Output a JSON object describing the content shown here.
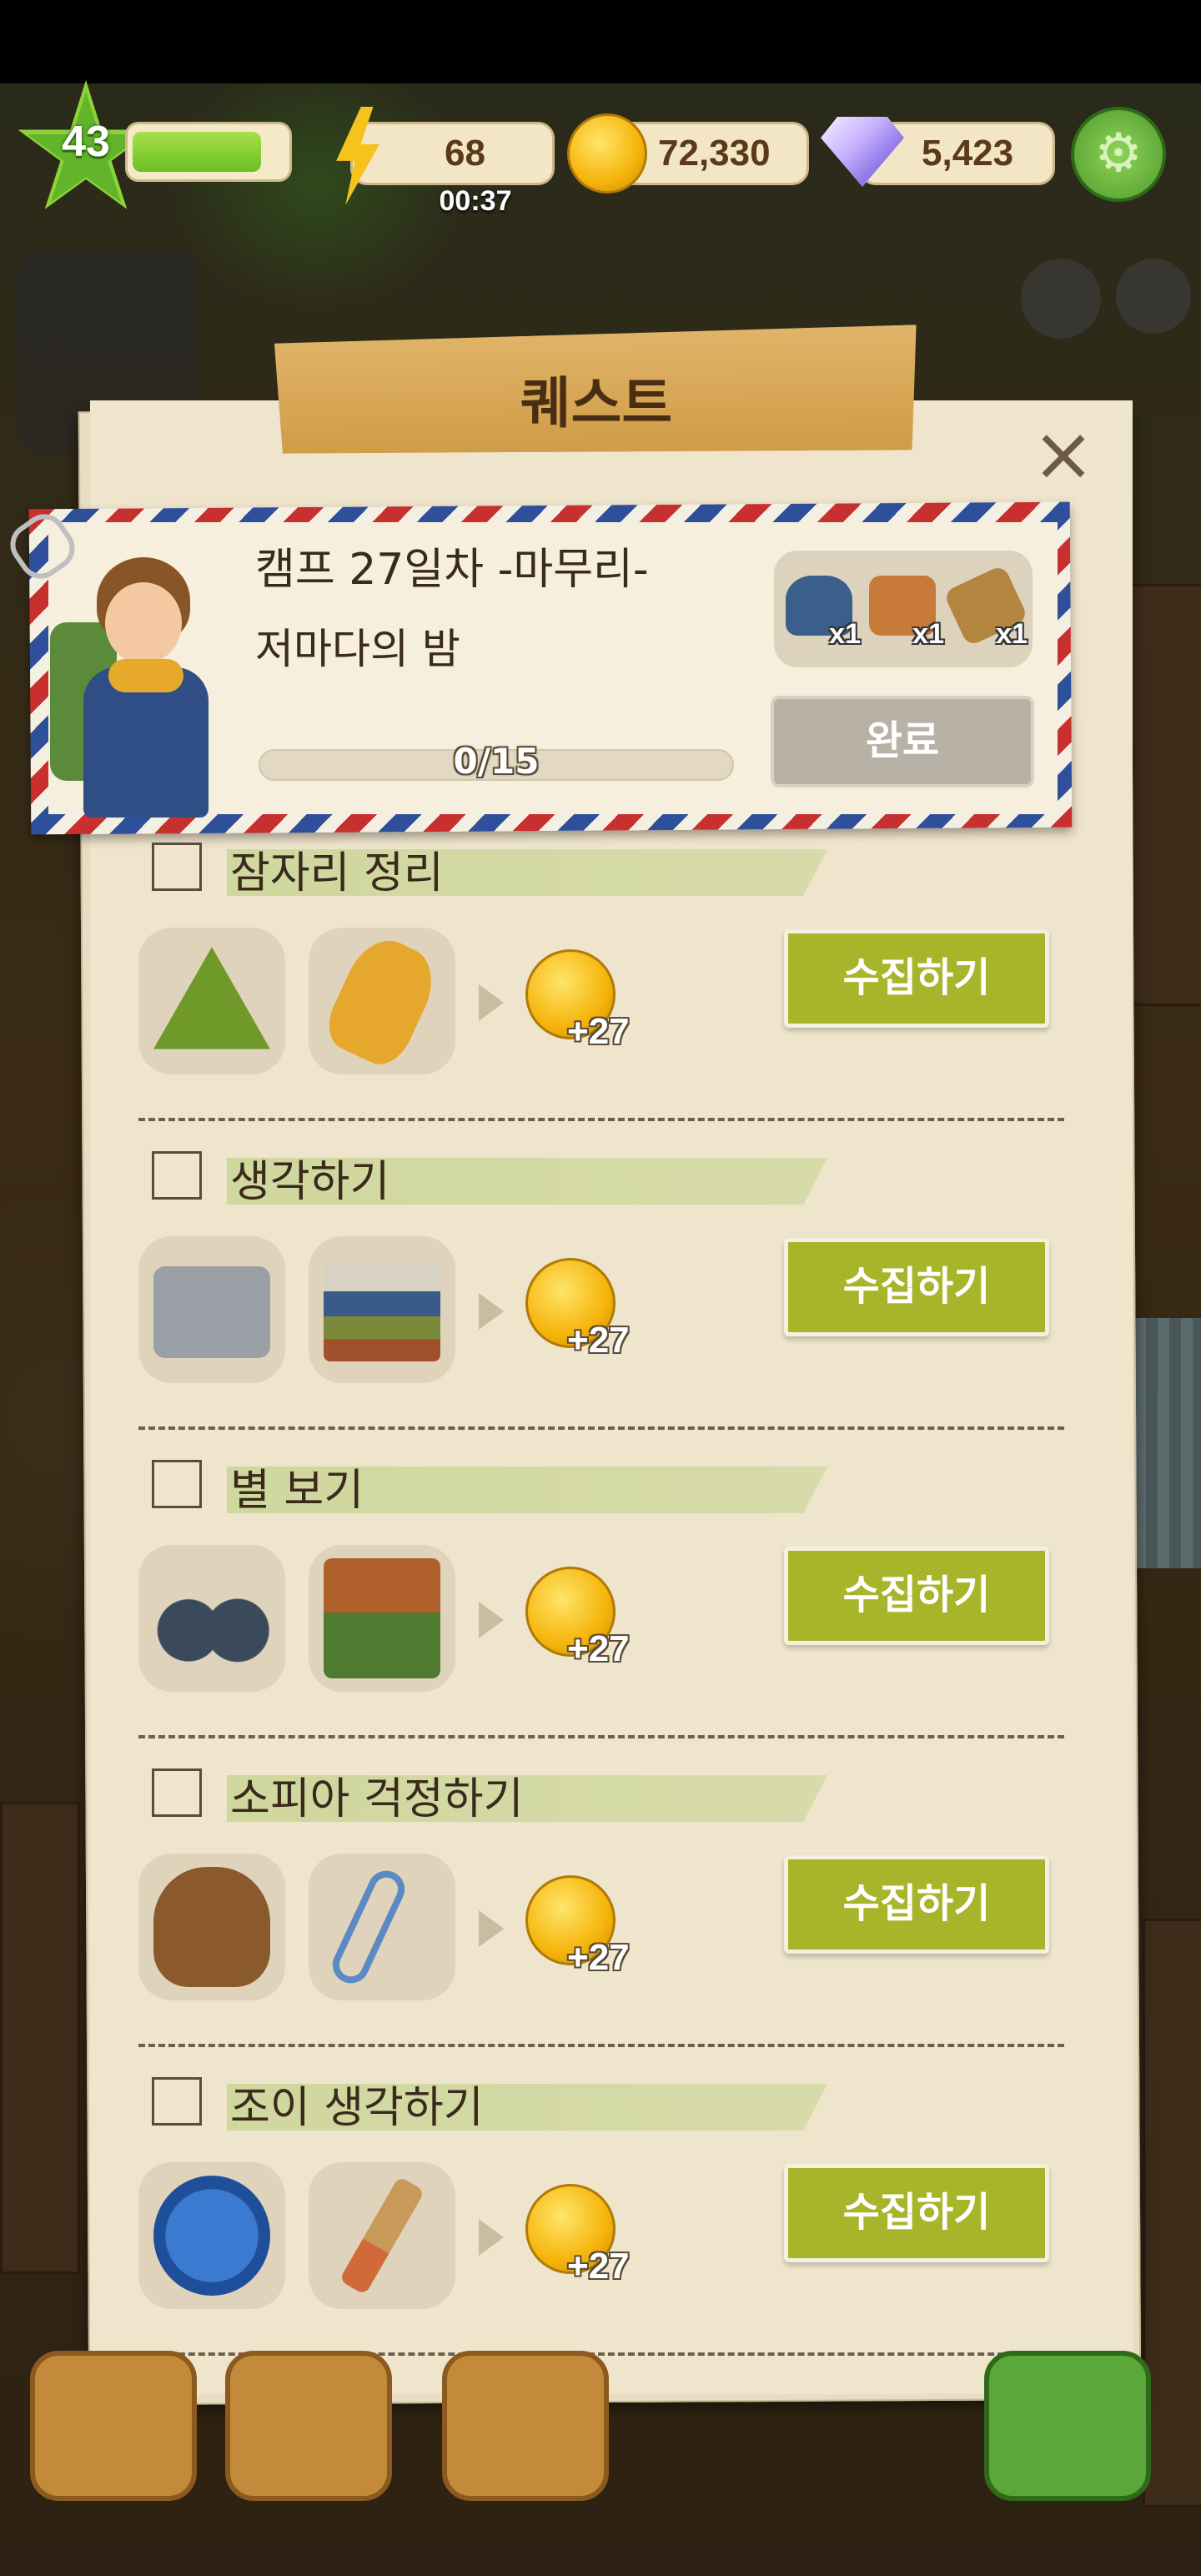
{
  "hud": {
    "level": "43",
    "xp_fraction": 0.82,
    "energy": "68",
    "energy_timer": "00:37",
    "coins": "72,330",
    "gems": "5,423"
  },
  "panel": {
    "title": "퀘스트",
    "close_icon": "×"
  },
  "quest": {
    "title": "캠프 27일차 -마무리-",
    "subtitle": "저마다의 밤",
    "progress": "0/15",
    "rewards": [
      {
        "icon": "bag-icon",
        "count": "x1",
        "color": "#3a5f8a"
      },
      {
        "icon": "chest-icon",
        "count": "x1",
        "color": "#c77a3a"
      },
      {
        "icon": "wallet-icon",
        "count": "x1",
        "color": "#b38640"
      }
    ],
    "complete_label": "완료"
  },
  "tasks": [
    {
      "name": "잠자리 정리",
      "items": [
        "tent-icon",
        "sleeping-bag-icon"
      ],
      "coin_reward": "+27",
      "collect_label": "수집하기"
    },
    {
      "name": "생각하기",
      "items": [
        "radio-icon",
        "books-icon"
      ],
      "coin_reward": "+27",
      "collect_label": "수집하기"
    },
    {
      "name": "별 보기",
      "items": [
        "binoculars-icon",
        "firewood-cart-icon"
      ],
      "coin_reward": "+27",
      "collect_label": "수집하기"
    },
    {
      "name": "소피아 걱정하기",
      "items": [
        "stool-icon",
        "safety-pin-icon"
      ],
      "coin_reward": "+27",
      "collect_label": "수집하기"
    },
    {
      "name": "조이 생각하기",
      "items": [
        "pincushion-icon",
        "paintbrush-icon"
      ],
      "coin_reward": "+27",
      "collect_label": "수집하기"
    }
  ],
  "colors": {
    "collect_button": "#a8b52a",
    "complete_button_disabled": "#b8b2a6",
    "paper": "#e8dcc3",
    "banner": "#d9a959"
  }
}
